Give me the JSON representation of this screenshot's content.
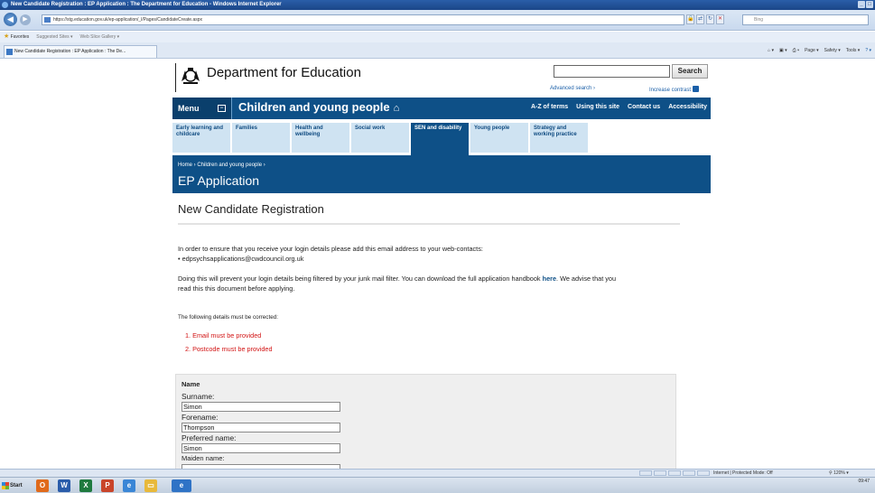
{
  "window": {
    "title": "New Candidate Registration : EP Application : The Department for Education - Windows Internet Explorer"
  },
  "browser": {
    "url": "https://stg.education.gov.uk/ep-application/_l/Pages/CandidateCreate.aspx",
    "search_placeholder": "Bing",
    "favorites_label": "Favorites",
    "fav_items": [
      "Suggested Sites ▾",
      "Web Slice Gallery ▾"
    ],
    "tab_title": "New Candidate Registration : EP Application : The De...",
    "command_items": [
      "Page ▾",
      "Safety ▾",
      "Tools ▾"
    ]
  },
  "header": {
    "brand": "Department for Education",
    "search_button": "Search",
    "advanced_search": "Advanced search ›",
    "increase_contrast": "Increase contrast"
  },
  "navbar": {
    "menu_label": "Menu",
    "section_title": "Children and young people",
    "links": [
      "A-Z of terms",
      "Using this site",
      "Contact us",
      "Accessibility"
    ]
  },
  "subnav": [
    "Early learning and childcare",
    "Families",
    "Health and wellbeing",
    "Social work",
    "SEN and disability",
    "Young people",
    "Strategy and working practice"
  ],
  "banner": {
    "breadcrumb": "Home ›  Children and young people ›",
    "title": "EP Application"
  },
  "main": {
    "title": "New Candidate Registration",
    "intro": "In order to ensure that you receive your login details please add this email address to your web-contacts:",
    "email": "• edpsychsapplications@cwdcouncil.org.uk",
    "handbook_pre": "Doing this will prevent your login details being filtered by your junk mail filter. You can download the full application handbook",
    "handbook_link": "here",
    "handbook_post": ". We advise that you",
    "handbook_line2": "read this this document before applying.",
    "errors_intro": "The following details must be corrected:",
    "errors": [
      "1.  Email must be provided",
      "2.  Postcode must be provided"
    ]
  },
  "form": {
    "section": "Name",
    "surname_label": "Surname:",
    "surname_value": "Simon",
    "forename_label": "Forename:",
    "forename_value": "Thompson",
    "preferred_label": "Preferred name:",
    "preferred_value": "Simon",
    "maiden_label": "Maiden name:"
  },
  "status": {
    "zone": "Internet | Protected Mode: Off",
    "zoom": "120%"
  },
  "taskbar": {
    "start": "Start",
    "time": "09:47"
  }
}
